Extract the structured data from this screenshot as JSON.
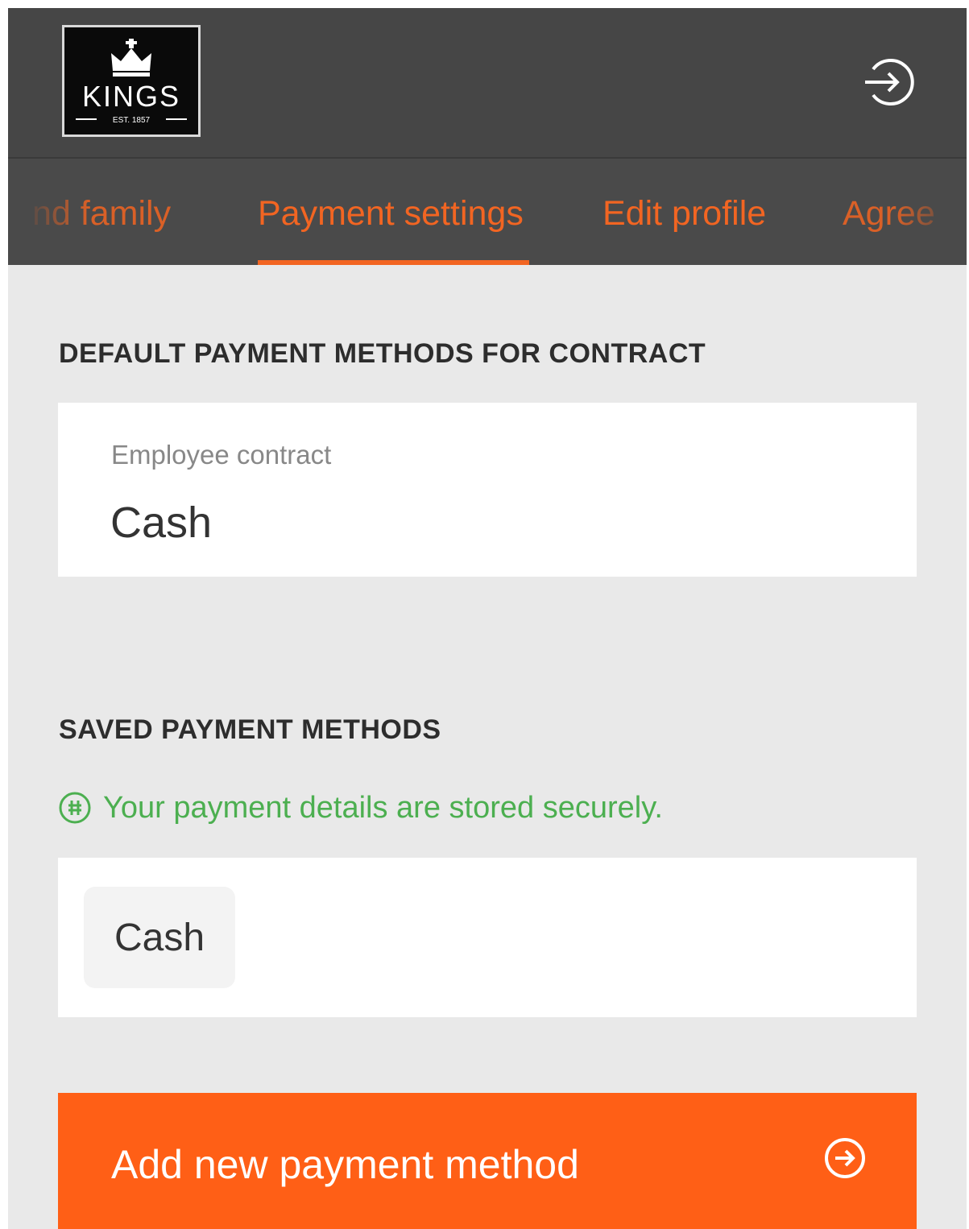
{
  "header": {
    "logo": {
      "brand": "KINGS",
      "tagline": "EST. 1857",
      "icon": "crown-icon"
    },
    "logout_icon": "logout-icon"
  },
  "tabs": [
    {
      "label": "nd family",
      "active": false
    },
    {
      "label": "Payment settings",
      "active": true
    },
    {
      "label": "Edit profile",
      "active": false
    },
    {
      "label": "Agree",
      "active": false
    }
  ],
  "default_methods": {
    "title": "DEFAULT PAYMENT METHODS FOR CONTRACT",
    "field_label": "Employee contract",
    "field_value": "Cash"
  },
  "saved_methods": {
    "title": "SAVED PAYMENT METHODS",
    "secure_icon": "secure-shield-icon",
    "secure_text": "Your payment details are stored securely.",
    "methods": [
      "Cash"
    ]
  },
  "add_button": {
    "label": "Add new payment method",
    "icon": "arrow-circle-right-icon"
  },
  "colors": {
    "accent": "#f26522",
    "button": "#ff5f16",
    "header": "#464646",
    "secure": "#4caf50",
    "background": "#e9e9e9"
  }
}
